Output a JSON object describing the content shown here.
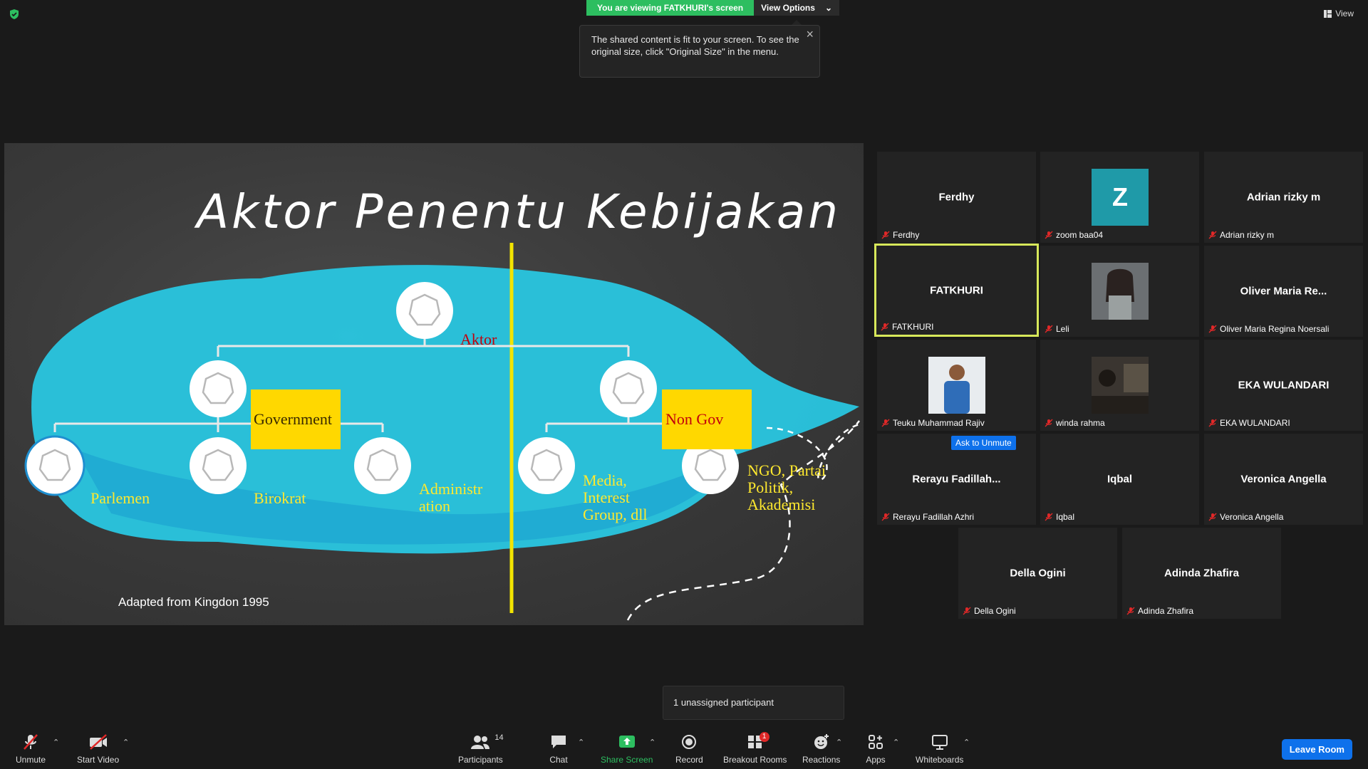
{
  "banner": {
    "viewing": "You are viewing FATKHURI's screen",
    "view_options": "View Options",
    "top_view": "View"
  },
  "tooltip": {
    "text": "The shared content is fit to your screen. To see the original size, click \"Original Size\" in the menu."
  },
  "slide": {
    "title": "Aktor Penentu Kebijakan",
    "root": "Aktor",
    "gov": "Government",
    "nongov": "Non Gov",
    "gov_children": [
      "Parlemen",
      "Birokrat",
      "Administr ation"
    ],
    "nongov_children": [
      "Media, Interest Group, dll",
      "NGO, Partai Politik, Akademisi"
    ],
    "source": "Adapted from Kingdon 1995"
  },
  "gallery": [
    {
      "center": "Ferdhy",
      "plate": "Ferdhy"
    },
    {
      "center": "Z",
      "plate": "zoom baa04"
    },
    {
      "center": "Adrian rizky m",
      "plate": "Adrian rizky m"
    },
    {
      "center": "FATKHURI",
      "plate": "FATKHURI"
    },
    {
      "center": "",
      "plate": "Leli"
    },
    {
      "center": "Oliver  Maria  Re...",
      "plate": "Oliver Maria Regina Noersali"
    },
    {
      "center": "",
      "plate": "Teuku Muhammad Rajiv"
    },
    {
      "center": "",
      "plate": "winda rahma"
    },
    {
      "center": "EKA WULANDARI",
      "plate": "EKA WULANDARI"
    },
    {
      "center": "Rerayu  Fadillah...",
      "plate": "Rerayu Fadillah Azhri"
    },
    {
      "center": "Iqbal",
      "plate": "Iqbal"
    },
    {
      "center": "Veronica Angella",
      "plate": "Veronica Angella"
    },
    {
      "center": "Della Ogini",
      "plate": "Della Ogini"
    },
    {
      "center": "Adinda Zhafira",
      "plate": "Adinda Zhafira"
    }
  ],
  "ask_to_unmute": "Ask to Unmute",
  "unassigned": "1 unassigned participant",
  "toolbar": {
    "unmute": "Unmute",
    "start_video": "Start Video",
    "participants": "Participants",
    "participants_count": "14",
    "chat": "Chat",
    "share_screen": "Share Screen",
    "record": "Record",
    "breakout": "Breakout Rooms",
    "breakout_badge": "1",
    "reactions": "Reactions",
    "apps": "Apps",
    "whiteboards": "Whiteboards",
    "leave": "Leave Room"
  },
  "colors": {
    "share_green": "#2dbe60",
    "active_border": "#d7e85a",
    "leave_blue": "#0e71eb",
    "slide_yellow": "#ffd800",
    "slide_blue": "#29c6e0"
  }
}
